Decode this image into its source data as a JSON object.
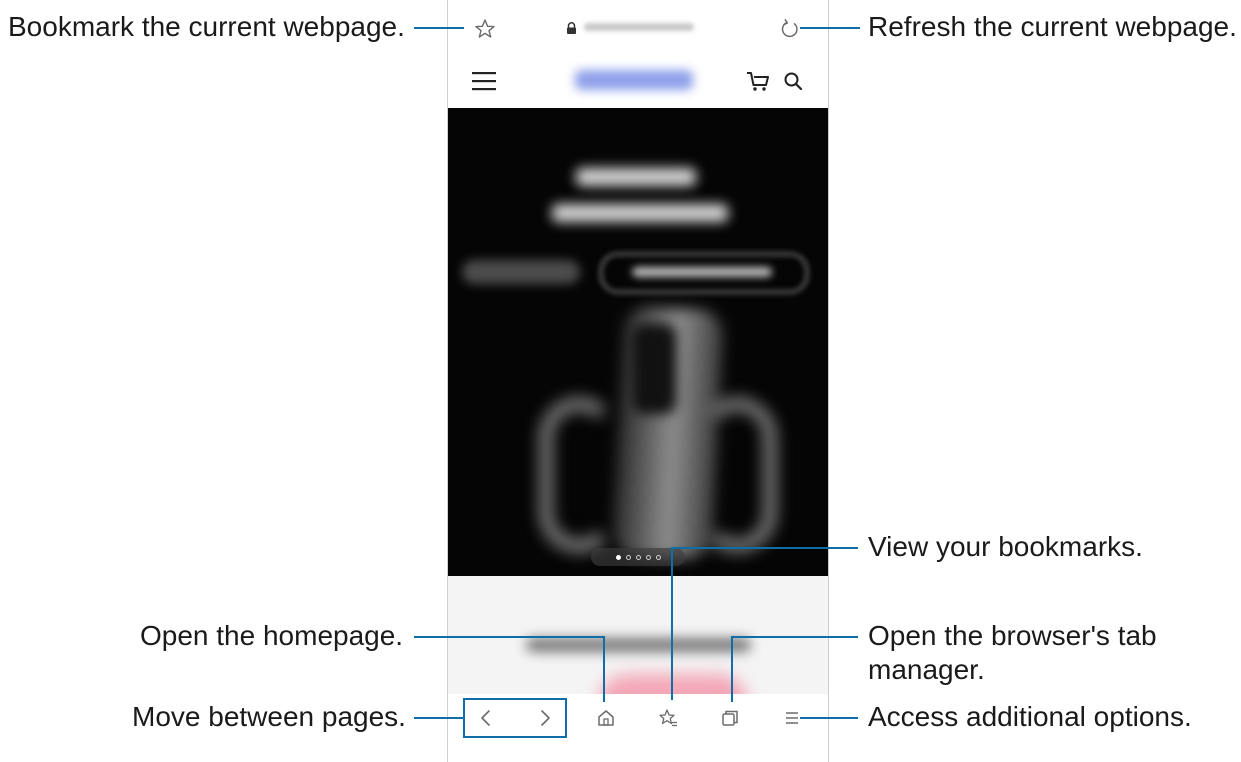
{
  "callouts": {
    "bookmark": "Bookmark the current webpage.",
    "refresh": "Refresh the current webpage.",
    "view_bookmarks": "View your bookmarks.",
    "homepage": "Open the homepage.",
    "tab_manager": "Open the browser's tab manager.",
    "move_pages": "Move between pages.",
    "additional_options": "Access additional options."
  },
  "hero": {
    "carousel": {
      "count": 5,
      "active": 1
    }
  },
  "colors": {
    "callout_line": "#0f6ea8",
    "hero_background": "#050505",
    "icon_gray": "#6b6b6b"
  },
  "icons": {
    "toolbar_top": [
      "star-icon",
      "lock-icon",
      "refresh-icon"
    ],
    "site_header": [
      "hamburger-icon",
      "cart-icon",
      "search-icon"
    ],
    "bottom_nav": [
      "back-icon",
      "forward-icon",
      "home-icon",
      "bookmarks-icon",
      "tabs-icon",
      "menu-icon"
    ]
  }
}
